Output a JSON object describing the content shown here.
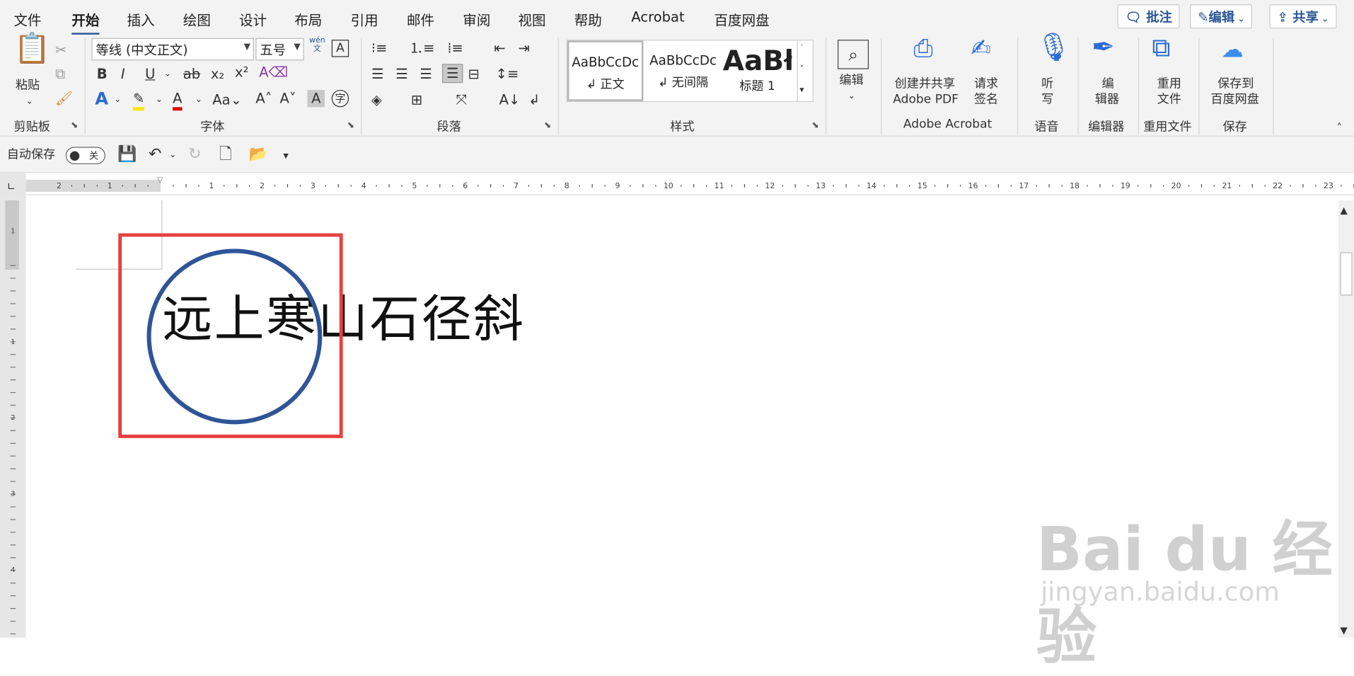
{
  "tabs": [
    "文件",
    "开始",
    "插入",
    "绘图",
    "设计",
    "布局",
    "引用",
    "邮件",
    "审阅",
    "视图",
    "帮助",
    "Acrobat",
    "百度网盘"
  ],
  "active_tab": "开始",
  "top_buttons": {
    "comment": "批注",
    "edit": "编辑",
    "share": "共享"
  },
  "clipboard": {
    "paste": "粘贴",
    "group": "剪贴板"
  },
  "font": {
    "name": "等线 (中文正文)",
    "size": "五号",
    "group": "字体",
    "wen": "wén",
    "wen_char": "文"
  },
  "paragraph": {
    "group": "段落"
  },
  "styles": {
    "items": [
      {
        "preview": "AaBbCcDc",
        "name": "↲ 正文"
      },
      {
        "preview": "AaBbCcDc",
        "name": "↲ 无间隔"
      },
      {
        "preview": "AaBł",
        "name": "标题 1"
      }
    ],
    "group": "样式"
  },
  "editing": {
    "label": "编辑"
  },
  "acrobat": {
    "create_label": "创建并共享\nAdobe PDF",
    "create_l1": "创建并共享",
    "create_l2": "Adobe PDF",
    "sign_l1": "请求",
    "sign_l2": "签名",
    "group": "Adobe Acrobat"
  },
  "voice": {
    "l1": "听",
    "l2": "写",
    "group": "语音"
  },
  "editor": {
    "l1": "编",
    "l2": "辑器",
    "group": "编辑器"
  },
  "reuse": {
    "l1": "重用",
    "l2": "文件",
    "group": "重用文件"
  },
  "save_baidu": {
    "l1": "保存到",
    "l2": "百度网盘",
    "group": "保存"
  },
  "qat": {
    "autosave": "自动保存",
    "toggle_state": "关"
  },
  "document": {
    "text": "远上寒山石径斜"
  },
  "ruler_numbers": [
    "2",
    "1",
    "1",
    "2",
    "3",
    "4",
    "5",
    "6",
    "7",
    "8",
    "9",
    "10",
    "11",
    "12",
    "13",
    "14",
    "15",
    "16",
    "17",
    "18",
    "19",
    "20",
    "21",
    "22",
    "23"
  ],
  "vruler_numbers": [
    "1",
    "1",
    "2",
    "3",
    "4"
  ],
  "watermark": {
    "logo": "Bai du 经验",
    "url": "jingyan.baidu.com"
  },
  "colors": {
    "accent": "#2b5797",
    "red_box": "#e84040",
    "circle": "#2f5597"
  }
}
